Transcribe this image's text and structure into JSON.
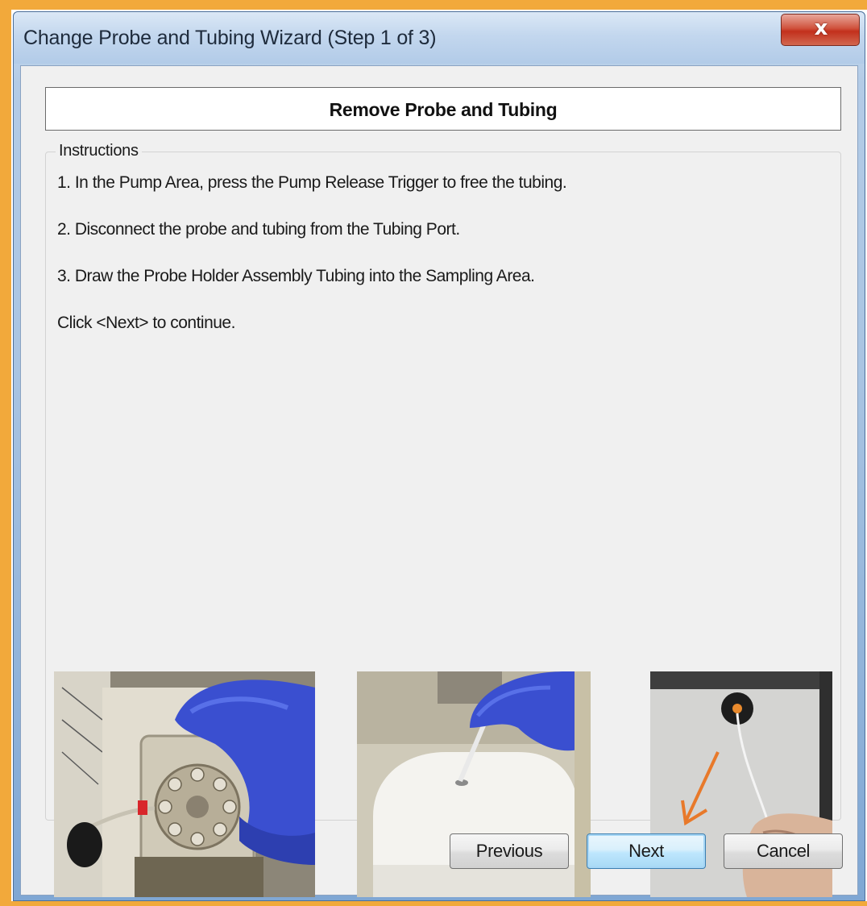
{
  "window": {
    "title": "Change Probe and Tubing Wizard (Step 1 of 3)",
    "close_glyph": "x"
  },
  "heading": "Remove Probe and Tubing",
  "instructions": {
    "group_label": "Instructions",
    "steps": [
      "1. In the Pump Area, press the Pump Release Trigger to free the tubing.",
      "2. Disconnect the probe and tubing from the Tubing Port.",
      "3. Draw the Probe Holder Assembly Tubing into the Sampling Area.",
      "Click <Next> to continue."
    ]
  },
  "photos": [
    {
      "icon": "pump-release-photo"
    },
    {
      "icon": "tubing-port-photo"
    },
    {
      "icon": "sampling-area-photo",
      "arrow_color": "#e8792a"
    }
  ],
  "buttons": {
    "previous": "Previous",
    "next": "Next",
    "cancel": "Cancel"
  },
  "colors": {
    "frame": "#f2a93b",
    "glove": "#3a4fd0",
    "close_button": "#c2301c"
  }
}
